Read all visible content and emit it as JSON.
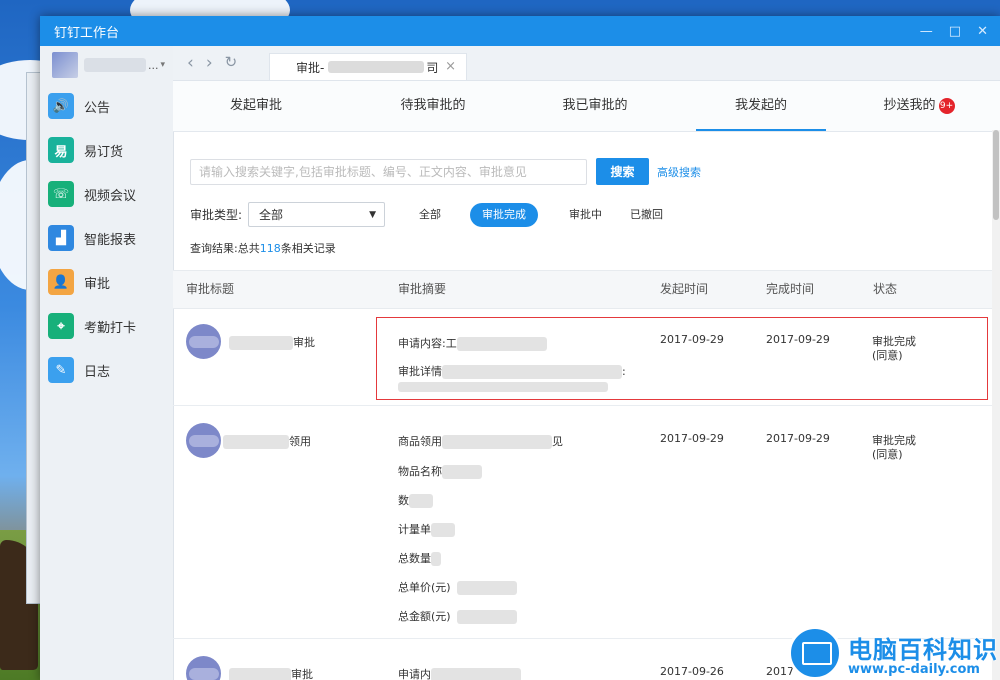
{
  "window": {
    "title": "钉钉工作台",
    "controls": [
      "—",
      "□",
      "✕"
    ]
  },
  "user": {
    "name_visible": "...",
    "caret": "▾"
  },
  "sidebar": {
    "items": [
      {
        "label": "公告",
        "icon": "megaphone-icon",
        "color": "#3ba0ee",
        "glyph": "🔊"
      },
      {
        "label": "易订货",
        "icon": "order-icon",
        "color": "#19b29b",
        "glyph": "易"
      },
      {
        "label": "视频会议",
        "icon": "phone-icon",
        "color": "#17b07a",
        "glyph": "☏"
      },
      {
        "label": "智能报表",
        "icon": "chart-icon",
        "color": "#2f88e0",
        "glyph": "▟"
      },
      {
        "label": "审批",
        "icon": "person-icon",
        "color": "#f3a543",
        "glyph": "👤"
      },
      {
        "label": "考勤打卡",
        "icon": "location-icon",
        "color": "#17b07a",
        "glyph": "⌖"
      },
      {
        "label": "日志",
        "icon": "notepad-icon",
        "color": "#3ba0ee",
        "glyph": "✎"
      }
    ]
  },
  "tabbar": {
    "back": "‹",
    "forward": "›",
    "refresh": "↻",
    "tab_prefix": "审批-",
    "tab_suffix": "司",
    "tab_close": "×"
  },
  "subtabs": [
    {
      "label": "发起审批"
    },
    {
      "label": "待我审批的"
    },
    {
      "label": "我已审批的"
    },
    {
      "label": "我发起的"
    },
    {
      "label": "抄送我的"
    }
  ],
  "cc_badge": "9+",
  "search": {
    "placeholder": "请输入搜索关键字,包括审批标题、编号、正文内容、审批意见",
    "button": "搜索",
    "advanced": "高级搜索"
  },
  "filter": {
    "type_label": "审批类型:",
    "type_value": "全部",
    "status_options": [
      "全部",
      "审批完成",
      "审批中",
      "已撤回"
    ]
  },
  "result": {
    "prefix": "查询结果:总共",
    "count": "118",
    "suffix": "条相关记录"
  },
  "table": {
    "headers": [
      "审批标题",
      "审批摘要",
      "发起时间",
      "完成时间",
      "状态"
    ],
    "rows": [
      {
        "title_suffix": "审批",
        "summary": [
          "申请内容:工",
          "审批详情",
          ":"
        ],
        "start": "2017-09-29",
        "end": "2017-09-29",
        "status": "审批完成",
        "status_note": "(同意)"
      },
      {
        "title_suffix": "领用",
        "summary": [
          "商品领用",
          "物品名称",
          "数",
          "计量单",
          "总数量",
          "总单价(元)",
          "总金额(元)"
        ],
        "summary_tail": "见",
        "start": "2017-09-29",
        "end": "2017-09-29",
        "status": "审批完成",
        "status_note": "(同意)"
      },
      {
        "title_suffix": "审批",
        "summary": [
          "申请内"
        ],
        "start": "2017-09-26",
        "end": "2017"
      }
    ]
  },
  "watermark": {
    "title": "电脑百科知识",
    "url": "www.pc-daily.com"
  }
}
